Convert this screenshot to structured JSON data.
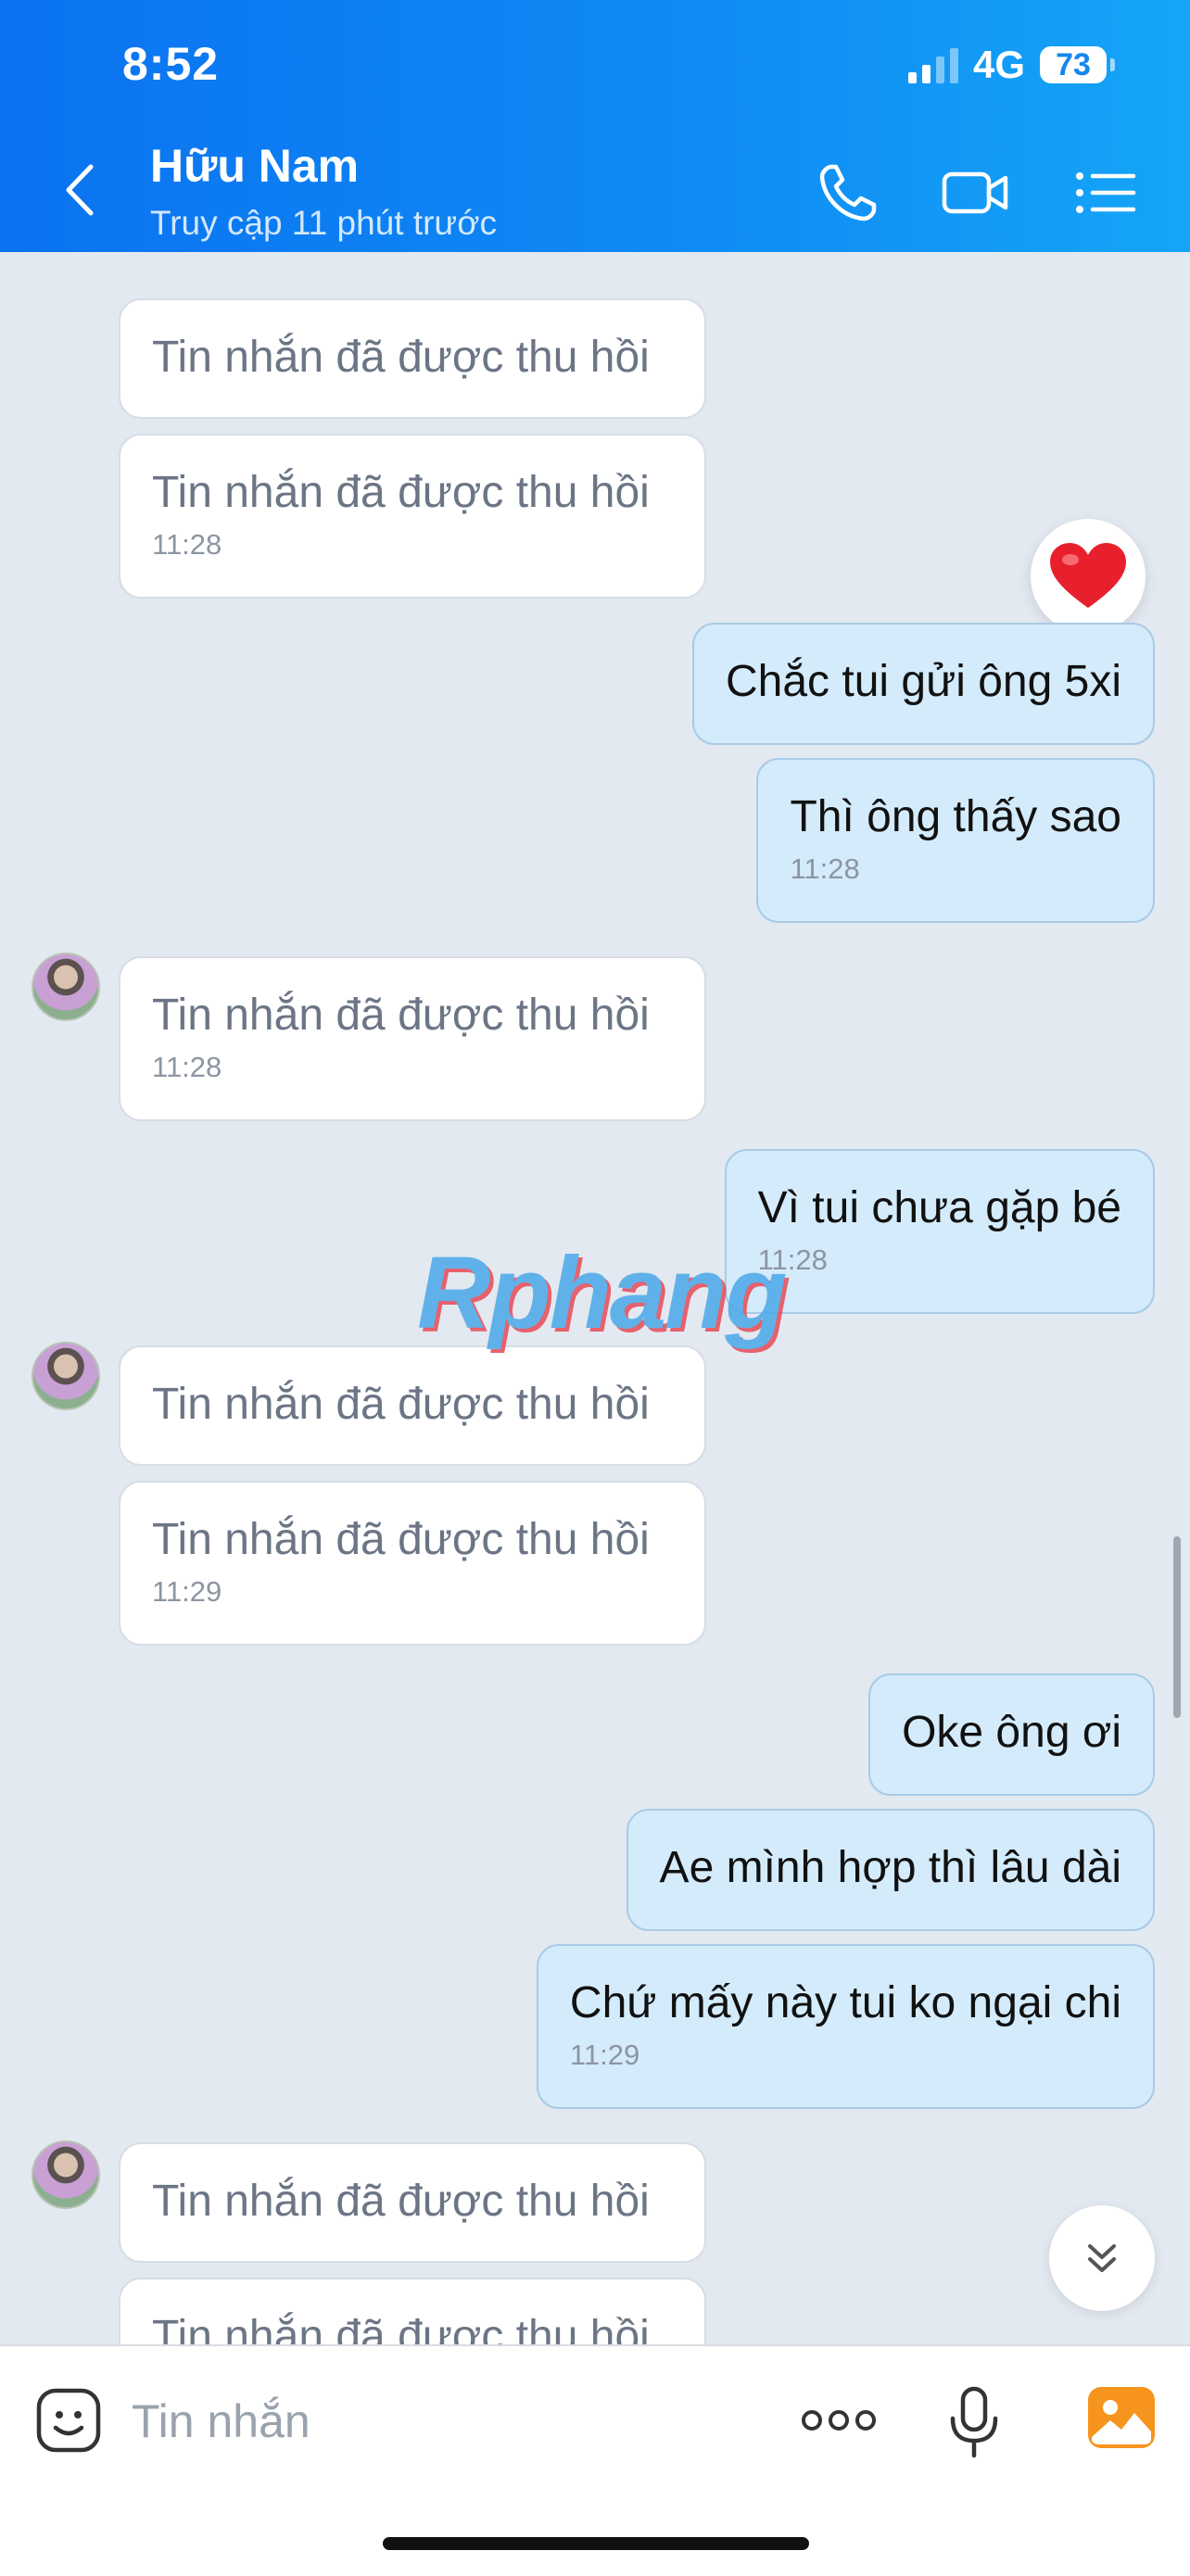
{
  "status_bar": {
    "time": "8:52",
    "network": "4G",
    "battery": "73"
  },
  "header": {
    "contact_name": "Hữu Nam",
    "contact_status": "Truy cập 11 phút trước"
  },
  "messages": [
    {
      "dir": "recv",
      "text": "Tin nhắn đã được thu hồi",
      "time": ""
    },
    {
      "dir": "recv",
      "text": "Tin nhắn đã được thu hồi",
      "time": "11:28"
    },
    {
      "dir": "sent",
      "text": "Chắc tui gửi ông 5xi",
      "time": ""
    },
    {
      "dir": "sent",
      "text": "Thì ông thấy sao",
      "time": "11:28"
    },
    {
      "dir": "recv",
      "text": "Tin nhắn đã được thu hồi",
      "time": "11:28"
    },
    {
      "dir": "sent",
      "text": "Vì tui chưa gặp bé",
      "time": "11:28"
    },
    {
      "dir": "recv",
      "text": "Tin nhắn đã được thu hồi",
      "time": ""
    },
    {
      "dir": "recv",
      "text": "Tin nhắn đã được thu hồi",
      "time": "11:29"
    },
    {
      "dir": "sent",
      "text": "Oke ông ơi",
      "time": ""
    },
    {
      "dir": "sent",
      "text": "Ae mình hợp thì lâu dài",
      "time": ""
    },
    {
      "dir": "sent",
      "text": "Chứ mấy này tui ko ngại chi",
      "time": "11:29"
    },
    {
      "dir": "recv",
      "text": "Tin nhắn đã được thu hồi",
      "time": ""
    },
    {
      "dir": "recv",
      "text": "Tin nhắn đã được thu hồi",
      "time": ""
    }
  ],
  "reaction": {
    "icon": "heart-icon",
    "color": "#e8202e"
  },
  "watermark": "Rphang",
  "input": {
    "placeholder": "Tin nhắn"
  },
  "colors": {
    "header": "#0f8cf5",
    "sent_bubble": "#d4ebfb",
    "received_bubble": "#ffffff",
    "background": "#e3e9f1"
  }
}
